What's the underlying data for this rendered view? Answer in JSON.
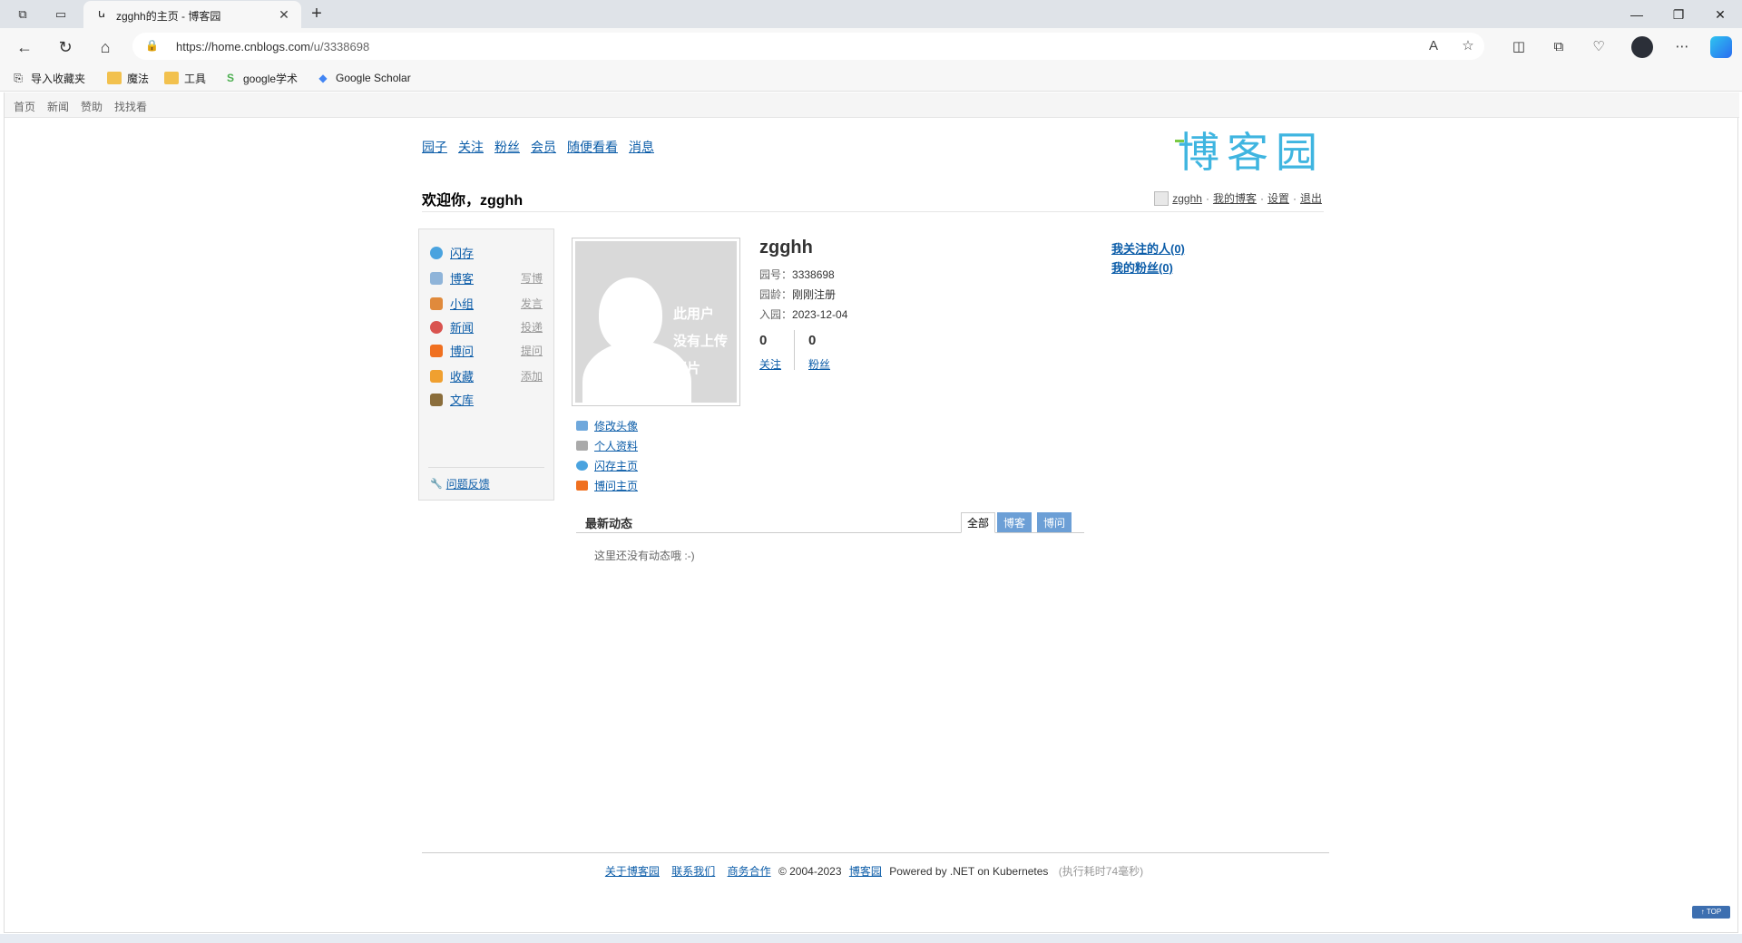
{
  "browser": {
    "tab_title": "zgghh的主页 - 博客园",
    "url_host": "https://home.cnblogs.com",
    "url_path": "/u/3338698",
    "bookmarks": [
      "导入收藏夹",
      "魔法",
      "工具",
      "google学术",
      "Google Scholar"
    ]
  },
  "site_nav": [
    "首页",
    "新闻",
    "赞助",
    "找找看"
  ],
  "main_nav": [
    "园子",
    "关注",
    "粉丝",
    "会员",
    "随便看看",
    "消息"
  ],
  "logo_text": "博客园",
  "welcome": "欢迎你，zgghh",
  "user_links": {
    "username": "zgghh",
    "sep": "·",
    "my_blog": "我的博客",
    "settings": "设置",
    "logout": "退出"
  },
  "sidebar": {
    "items": [
      {
        "label": "闪存",
        "action": "",
        "color": "#4aa3df"
      },
      {
        "label": "博客",
        "action": "写博",
        "color": "#8fb4d9"
      },
      {
        "label": "小组",
        "action": "发言",
        "color": "#e08a3c"
      },
      {
        "label": "新闻",
        "action": "投递",
        "color": "#d9534f"
      },
      {
        "label": "博问",
        "action": "提问",
        "color": "#f07020"
      },
      {
        "label": "收藏",
        "action": "添加",
        "color": "#f0a030"
      },
      {
        "label": "文库",
        "action": "",
        "color": "#8a6d3b"
      }
    ],
    "feedback": "问题反馈"
  },
  "profile": {
    "avatar_text": [
      "此用户",
      "没有上传",
      "照片"
    ],
    "name": "zgghh",
    "id_label": "园号：",
    "id_value": "3338698",
    "age_label": "园龄：",
    "age_value": "刚刚注册",
    "joined_label": "入园：",
    "joined_value": "2023-12-04",
    "following_count": "0",
    "following_label": "关注",
    "followers_count": "0",
    "followers_label": "粉丝",
    "my_following": "我关注的人(0)",
    "my_followers": "我的粉丝(0)"
  },
  "profile_links": [
    "修改头像",
    "个人资料",
    "闪存主页",
    "博问主页"
  ],
  "activity": {
    "title": "最新动态",
    "tabs": [
      "全部",
      "博客",
      "博问"
    ],
    "empty": "这里还没有动态哦 :-)"
  },
  "footer": {
    "links": [
      "关于博客园",
      "联系我们",
      "商务合作"
    ],
    "copyright": "© 2004-2023",
    "brand": "博客园",
    "powered": "Powered by .NET on Kubernetes",
    "timing": "(执行耗时74毫秒)"
  },
  "top_button": "↑ TOP"
}
